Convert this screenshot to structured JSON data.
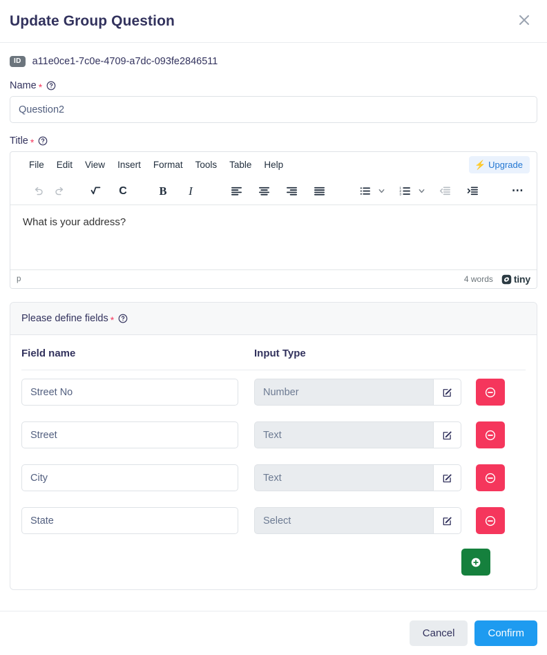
{
  "header": {
    "title": "Update Group Question",
    "close_label": "×"
  },
  "record": {
    "id_badge": "ID",
    "id_value": "a11e0ce1-7c0e-4709-a7dc-093fe2846511"
  },
  "name_field": {
    "label": "Name",
    "required_mark": "*",
    "value": "Question2"
  },
  "title_field": {
    "label": "Title",
    "required_mark": "*"
  },
  "editor": {
    "menubar": [
      "File",
      "Edit",
      "View",
      "Insert",
      "Format",
      "Tools",
      "Table",
      "Help"
    ],
    "upgrade_label": "Upgrade",
    "content": "What is your address?",
    "statusbar": {
      "path": "p",
      "word_count": "4 words",
      "brand": "tiny"
    },
    "toolbar": [
      "undo-icon",
      "redo-icon",
      "math-icon",
      "chemistry-icon",
      "bold-icon",
      "italic-icon",
      "align-left-icon",
      "align-center-icon",
      "align-right-icon",
      "align-justify-icon",
      "bullet-list-icon",
      "numbered-list-icon",
      "outdent-icon",
      "indent-icon",
      "more-icon"
    ]
  },
  "fields_card": {
    "header_label": "Please define fields",
    "required_mark": "*",
    "columns": [
      "Field name",
      "Input Type"
    ],
    "rows": [
      {
        "name": "Street No",
        "type": "Number"
      },
      {
        "name": "Street",
        "type": "Text"
      },
      {
        "name": "City",
        "type": "Text"
      },
      {
        "name": "State",
        "type": "Select"
      }
    ]
  },
  "footer": {
    "cancel_label": "Cancel",
    "confirm_label": "Confirm"
  },
  "colors": {
    "accent_blue": "#1e9bf0",
    "danger_red": "#f5365c",
    "success_green": "#15803d",
    "required_red": "#f5365c",
    "upgrade_orange": "#ff8b00",
    "text_navy": "#32325d"
  }
}
